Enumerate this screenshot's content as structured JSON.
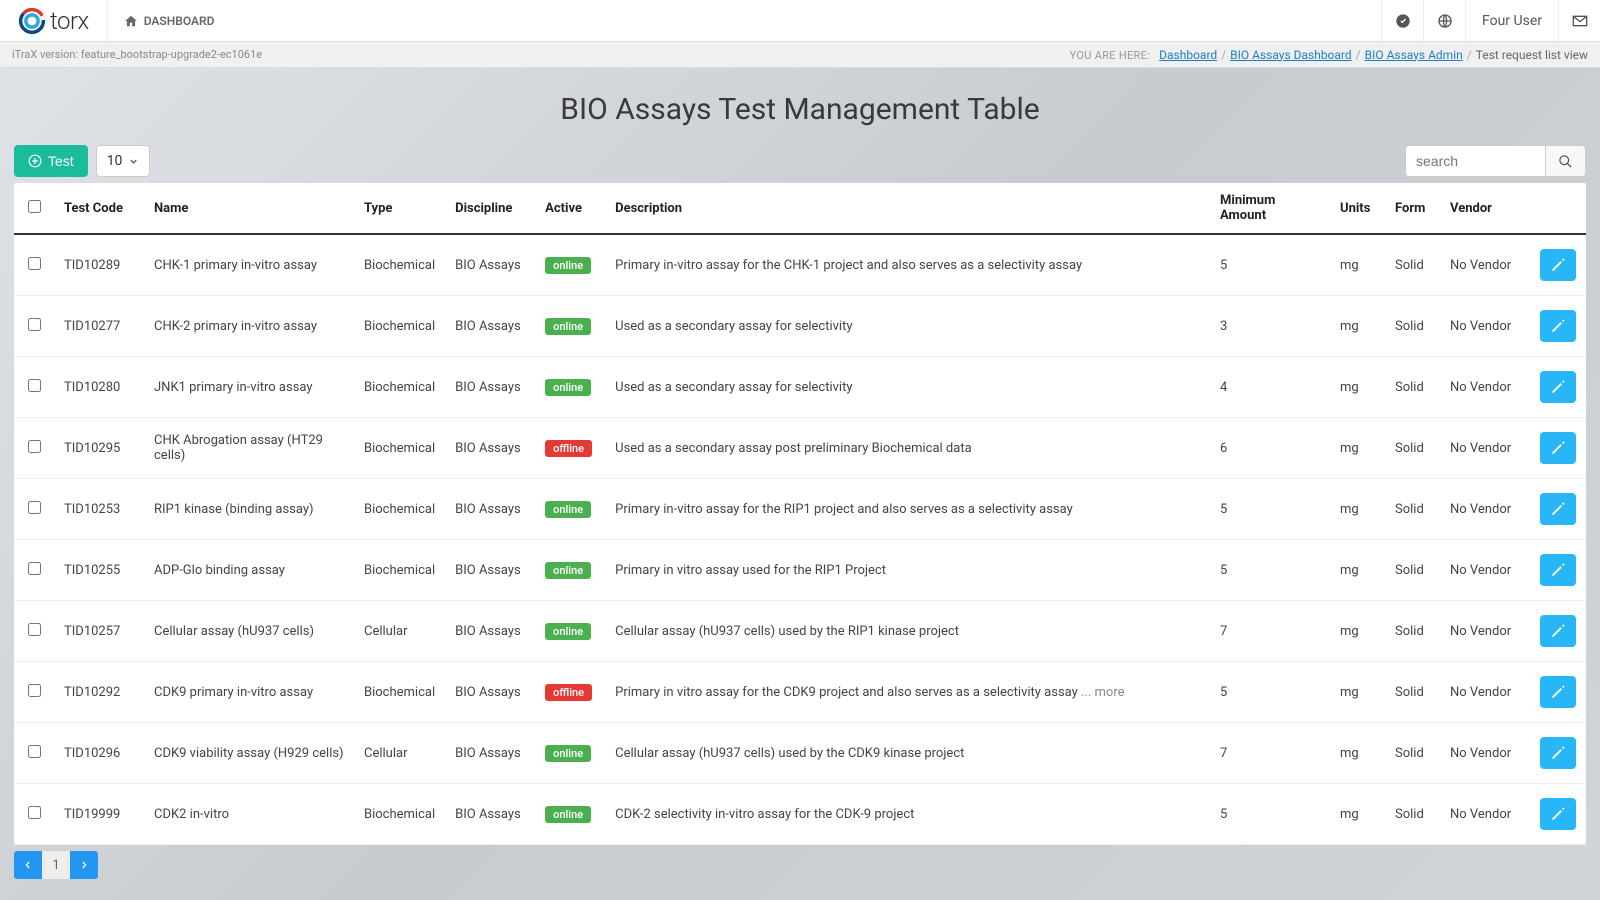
{
  "app": {
    "logo_text": "torx",
    "dashboard_label": "DASHBOARD",
    "version_label": "iTraX version: feature_bootstrap-upgrade2-ec1061e",
    "user_name": "Four User"
  },
  "breadcrumb": {
    "you_are_here": "YOU ARE HERE:",
    "items": [
      {
        "label": "Dashboard",
        "link": true
      },
      {
        "label": "BIO Assays Dashboard",
        "link": true
      },
      {
        "label": "BIO Assays Admin",
        "link": true
      },
      {
        "label": "Test request list view",
        "link": false
      }
    ]
  },
  "page_title": "BIO Assays Test Management Table",
  "toolbar": {
    "test_label": "Test",
    "page_size": "10",
    "search_placeholder": "search"
  },
  "columns": {
    "test_code": "Test Code",
    "name": "Name",
    "type": "Type",
    "discipline": "Discipline",
    "active": "Active",
    "description": "Description",
    "min_amount": "Minimum Amount",
    "units": "Units",
    "form": "Form",
    "vendor": "Vendor"
  },
  "status_labels": {
    "online": "online",
    "offline": "offline"
  },
  "rows": [
    {
      "test_code": "TID10289",
      "name": "CHK-1 primary in-vitro assay",
      "type": "Biochemical",
      "discipline": "BIO Assays",
      "active": "online",
      "description": "Primary in-vitro assay for the CHK-1 project and also serves as a selectivity assay",
      "min_amount": "5",
      "units": "mg",
      "form": "Solid",
      "vendor": "No Vendor"
    },
    {
      "test_code": "TID10277",
      "name": "CHK-2 primary in-vitro assay",
      "type": "Biochemical",
      "discipline": "BIO Assays",
      "active": "online",
      "description": "Used as a secondary assay for selectivity",
      "min_amount": "3",
      "units": "mg",
      "form": "Solid",
      "vendor": "No Vendor"
    },
    {
      "test_code": "TID10280",
      "name": "JNK1 primary in-vitro assay",
      "type": "Biochemical",
      "discipline": "BIO Assays",
      "active": "online",
      "description": "Used as a secondary assay for selectivity",
      "min_amount": "4",
      "units": "mg",
      "form": "Solid",
      "vendor": "No Vendor"
    },
    {
      "test_code": "TID10295",
      "name": "CHK Abrogation assay (HT29 cells)",
      "type": "Biochemical",
      "discipline": "BIO Assays",
      "active": "offline",
      "description": "Used as a secondary assay post preliminary Biochemical data",
      "min_amount": "6",
      "units": "mg",
      "form": "Solid",
      "vendor": "No Vendor"
    },
    {
      "test_code": "TID10253",
      "name": "RIP1 kinase (binding assay)",
      "type": "Biochemical",
      "discipline": "BIO Assays",
      "active": "online",
      "description": "Primary in-vitro assay for the RIP1 project and also serves as a selectivity assay",
      "min_amount": "5",
      "units": "mg",
      "form": "Solid",
      "vendor": "No Vendor"
    },
    {
      "test_code": "TID10255",
      "name": "ADP-Glo binding assay",
      "type": "Biochemical",
      "discipline": "BIO Assays",
      "active": "online",
      "description": "Primary in vitro assay used for the RIP1 Project",
      "min_amount": "5",
      "units": "mg",
      "form": "Solid",
      "vendor": "No Vendor"
    },
    {
      "test_code": "TID10257",
      "name": "Cellular assay (hU937 cells)",
      "type": "Cellular",
      "discipline": "BIO Assays",
      "active": "online",
      "description": "Cellular assay (hU937 cells) used by the RIP1 kinase project",
      "min_amount": "7",
      "units": "mg",
      "form": "Solid",
      "vendor": "No Vendor"
    },
    {
      "test_code": "TID10292",
      "name": "CDK9 primary in-vitro assay",
      "type": "Biochemical",
      "discipline": "BIO Assays",
      "active": "offline",
      "description": "Primary in vitro assay for the CDK9 project and also serves as a selectivity assay",
      "more": " ... more",
      "min_amount": "5",
      "units": "mg",
      "form": "Solid",
      "vendor": "No Vendor"
    },
    {
      "test_code": "TID10296",
      "name": "CDK9 viability assay (H929 cells)",
      "type": "Cellular",
      "discipline": "BIO Assays",
      "active": "online",
      "description": "Cellular assay (hU937 cells) used by the CDK9 kinase project",
      "min_amount": "7",
      "units": "mg",
      "form": "Solid",
      "vendor": "No Vendor"
    },
    {
      "test_code": "TID19999",
      "name": "CDK2 in-vitro",
      "type": "Biochemical",
      "discipline": "BIO Assays",
      "active": "online",
      "description": "CDK-2 selectivity in-vitro assay for the CDK-9 project",
      "min_amount": "5",
      "units": "mg",
      "form": "Solid",
      "vendor": "No Vendor"
    }
  ],
  "pagination": {
    "current": "1"
  }
}
